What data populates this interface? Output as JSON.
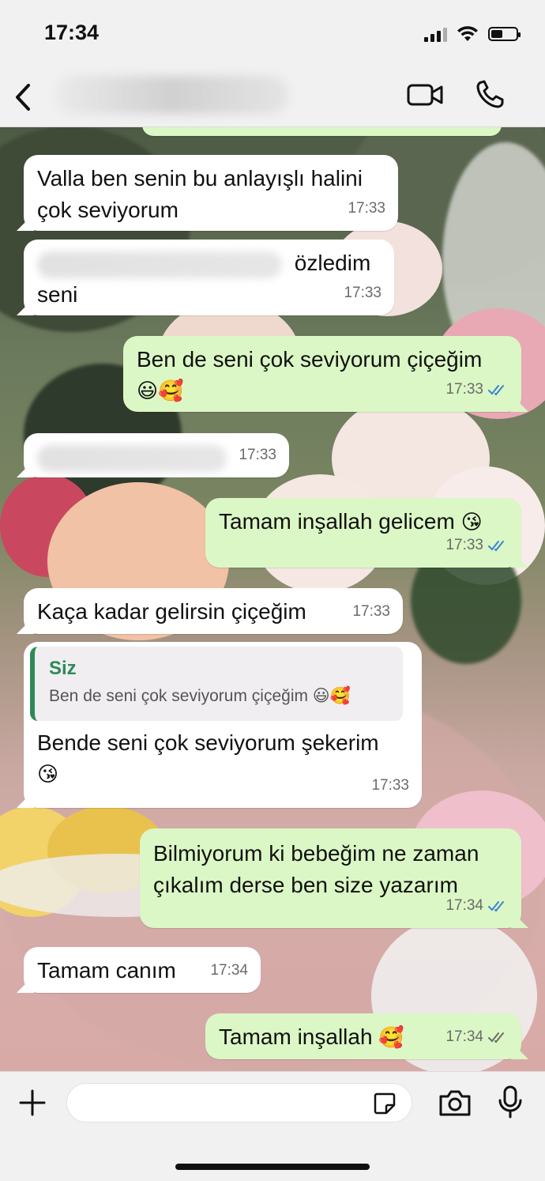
{
  "status_bar": {
    "time": "17:34"
  },
  "icons": {
    "back": "chevron-left-icon",
    "video": "video-camera-icon",
    "call": "phone-icon",
    "add": "plus-icon",
    "sticker": "sticker-icon",
    "camera": "camera-icon",
    "mic": "microphone-icon",
    "read": "double-check-icon"
  },
  "colors": {
    "outgoing_bubble": "#dbf7c5",
    "incoming_bubble": "#ffffff",
    "read_tick": "#3a82d6",
    "delivered_tick": "#6b6b6b",
    "quote_accent": "#2e8a55"
  },
  "messages": [
    {
      "direction": "in",
      "text_line1": "Valla ben senin bu anlayışlı halini",
      "text_line2": "çok seviyorum",
      "time": "17:33"
    },
    {
      "direction": "in",
      "text_after_blur": "özledim",
      "text_line2": "seni",
      "time": "17:33"
    },
    {
      "direction": "out",
      "text": "Ben de seni çok seviyorum çiçeğim",
      "emoji": "😃🥰",
      "time": "17:33",
      "status": "read"
    },
    {
      "direction": "in",
      "time": "17:33"
    },
    {
      "direction": "out",
      "text": "Tamam inşallah gelicem",
      "emoji": "😘",
      "time": "17:33",
      "status": "read"
    },
    {
      "direction": "in",
      "text": "Kaça kadar gelirsin çiçeğim",
      "time": "17:33"
    },
    {
      "direction": "in",
      "quote_name": "Siz",
      "quote_text": "Ben de seni çok seviyorum çiçeğim 😃🥰",
      "text": "Bende seni çok seviyorum şekerim",
      "emoji": "😘",
      "time": "17:33"
    },
    {
      "direction": "out",
      "text_line1": "Bilmiyorum ki bebeğim ne zaman",
      "text_line2": "çıkalım derse ben size yazarım",
      "time": "17:34",
      "status": "read"
    },
    {
      "direction": "in",
      "text": "Tamam canım",
      "time": "17:34"
    },
    {
      "direction": "out",
      "text": "Tamam inşallah",
      "emoji": "🥰",
      "time": "17:34",
      "status": "delivered"
    }
  ]
}
